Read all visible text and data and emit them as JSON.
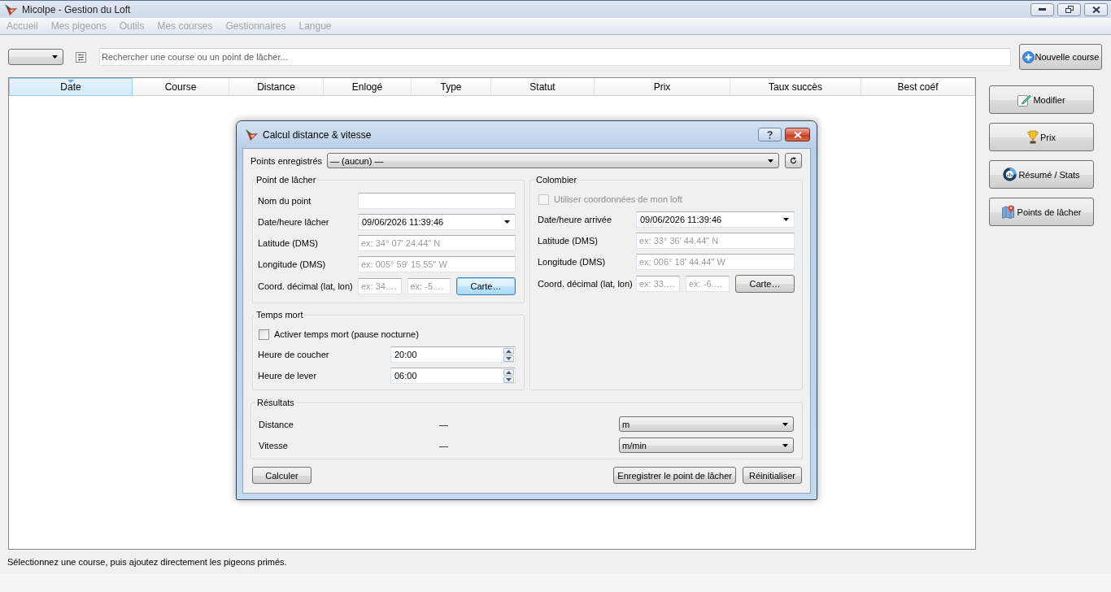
{
  "window": {
    "title": "Micolpe - Gestion du Loft"
  },
  "menu": [
    {
      "label": "Accueil",
      "disabled": true
    },
    {
      "label": "Mes pigeons",
      "disabled": true
    },
    {
      "label": "Outils",
      "disabled": true
    },
    {
      "label": "Mes courses",
      "disabled": true
    },
    {
      "label": "Gestionnaires",
      "disabled": true
    },
    {
      "label": "Langue",
      "disabled": true
    }
  ],
  "toolbar": {
    "search": {
      "placeholder": "Rechercher une course ou un point de lâcher..."
    },
    "new_button": "Nouvelle course"
  },
  "table": {
    "columns": [
      {
        "label": "Date",
        "selected": true
      },
      {
        "label": "Course",
        "selected": false
      },
      {
        "label": "Distance",
        "selected": false
      },
      {
        "label": "Enlogé",
        "selected": false
      },
      {
        "label": "Type",
        "selected": false
      },
      {
        "label": "Statut",
        "selected": false
      },
      {
        "label": "Prix",
        "selected": false
      },
      {
        "label": "Taux succès",
        "selected": false
      },
      {
        "label": "Best coéf",
        "selected": false
      }
    ]
  },
  "side_buttons": [
    "Modifier",
    "Prix",
    "Résumé / Stats",
    "Points de lâcher"
  ],
  "status_bar": "Sélectionnez une course, puis ajoutez directement les pigeons primés.",
  "dialog": {
    "title": "Calcul distance & vitesse",
    "saved_points": {
      "label": "Points enregistrés",
      "value": "— (aucun) —"
    },
    "release_point": {
      "title": "Point de lâcher",
      "rows": [
        {
          "kind": "text",
          "label": "Nom du point"
        },
        {
          "kind": "combo",
          "label": "Date/heure lâcher",
          "value": "09/06/2026 11:39:46"
        },
        {
          "kind": "text",
          "label": "Latitude (DMS)",
          "placeholder": "ex: 34° 07' 24.44\" N"
        },
        {
          "kind": "text",
          "label": "Longitude (DMS)",
          "placeholder": "ex: 005° 59' 15.55\" W"
        },
        {
          "kind": "decimal",
          "label": "Coord. décimal (lat, lon)",
          "placeholders": [
            "ex: 34.…",
            "ex: -5.…"
          ],
          "button": {
            "label": "Carte…",
            "focused": true
          }
        }
      ]
    },
    "dead_time": {
      "title": "Temps mort",
      "checkbox": {
        "label": "Activer temps mort (pause nocturne)",
        "checked": false,
        "disabled": false
      },
      "spins": [
        {
          "label": "Heure de coucher",
          "value": "20:00"
        },
        {
          "label": "Heure de lever",
          "value": "06:00"
        }
      ]
    },
    "loft": {
      "title": "Colombier",
      "checkbox": {
        "label": "Utiliser coordonnées de mon loft",
        "checked": false,
        "disabled": true
      },
      "rows": [
        {
          "kind": "combo",
          "label": "Date/heure arrivée",
          "value": "09/06/2026 11:39:46"
        },
        {
          "kind": "text",
          "label": "Latitude (DMS)",
          "placeholder": "ex: 33° 36' 44.44\" N"
        },
        {
          "kind": "text",
          "label": "Longitude (DMS)",
          "placeholder": "ex: 006° 18' 44.44\" W"
        },
        {
          "kind": "decimal",
          "label": "Coord. décimal (lat, lon)",
          "placeholders": [
            "ex: 33.…",
            "ex: -6.…"
          ],
          "button": {
            "label": "Carte…",
            "focused": false
          }
        }
      ]
    },
    "results": {
      "title": "Résultats",
      "rows": [
        {
          "label": "Distance",
          "value": "—",
          "unit": "m"
        },
        {
          "label": "Vitesse",
          "value": "—",
          "unit": "m/min"
        }
      ]
    },
    "buttons": {
      "left": [
        "Calculer"
      ],
      "right": [
        "Enregistrer le point de lâcher",
        "Réinitialiser"
      ]
    }
  }
}
